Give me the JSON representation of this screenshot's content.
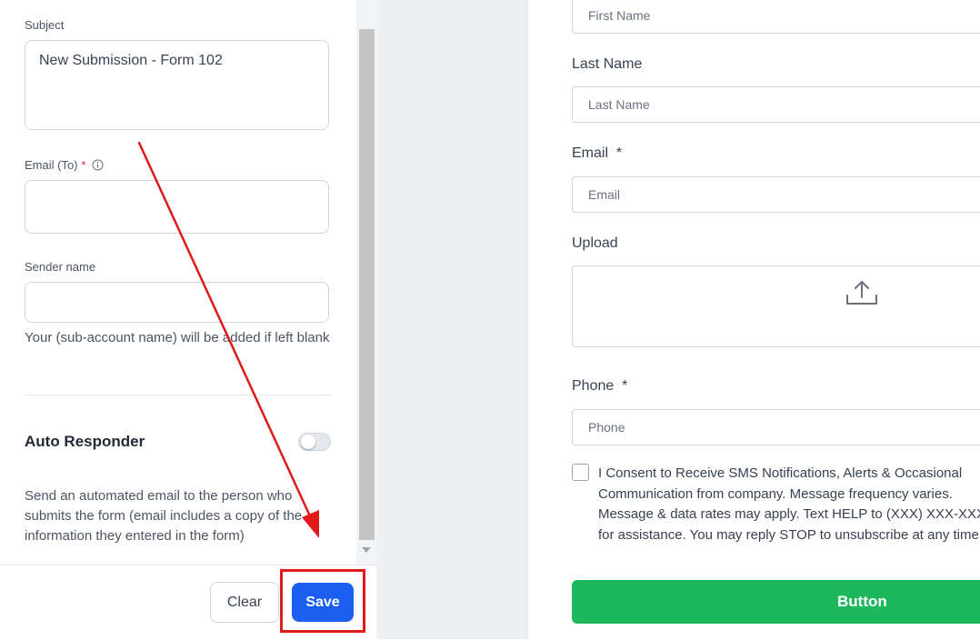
{
  "settings": {
    "subject_label": "Subject",
    "subject_value": "New Submission - Form 102",
    "email_to_label": "Email (To)",
    "email_to_required": "*",
    "email_to_value": "",
    "sender_name_label": "Sender name",
    "sender_name_value": "",
    "sender_name_helper": "Your (sub-account name) will be added if left blank",
    "auto_responder_title": "Auto Responder",
    "auto_responder_enabled": false,
    "auto_responder_description": "Send an automated email to the person who submits the form (email includes a copy of the information they entered in the form)"
  },
  "footer": {
    "clear_label": "Clear",
    "save_label": "Save"
  },
  "form_preview": {
    "first_name_placeholder": "First Name",
    "last_name_label": "Last Name",
    "last_name_placeholder": "Last Name",
    "email_label": "Email  *",
    "email_placeholder": "Email",
    "upload_label": "Upload",
    "phone_label": "Phone  *",
    "phone_placeholder": "Phone",
    "consent_text": "I Consent to Receive SMS Notifications, Alerts & Occasional Communication from company. Message frequency varies. Message & data rates may apply. Text HELP to (XXX) XXX-XXXX for assistance. You may reply STOP to unsubscribe at any time.",
    "button_label": "Button"
  },
  "colors": {
    "save_button": "#1a5ff0",
    "form_button": "#1cb85b",
    "annotation": "#e11919",
    "required": "#e11d48"
  },
  "icons": [
    "info-icon",
    "upload-icon",
    "toggle-switch",
    "scroll-down-arrow-icon",
    "annotation-arrow"
  ]
}
